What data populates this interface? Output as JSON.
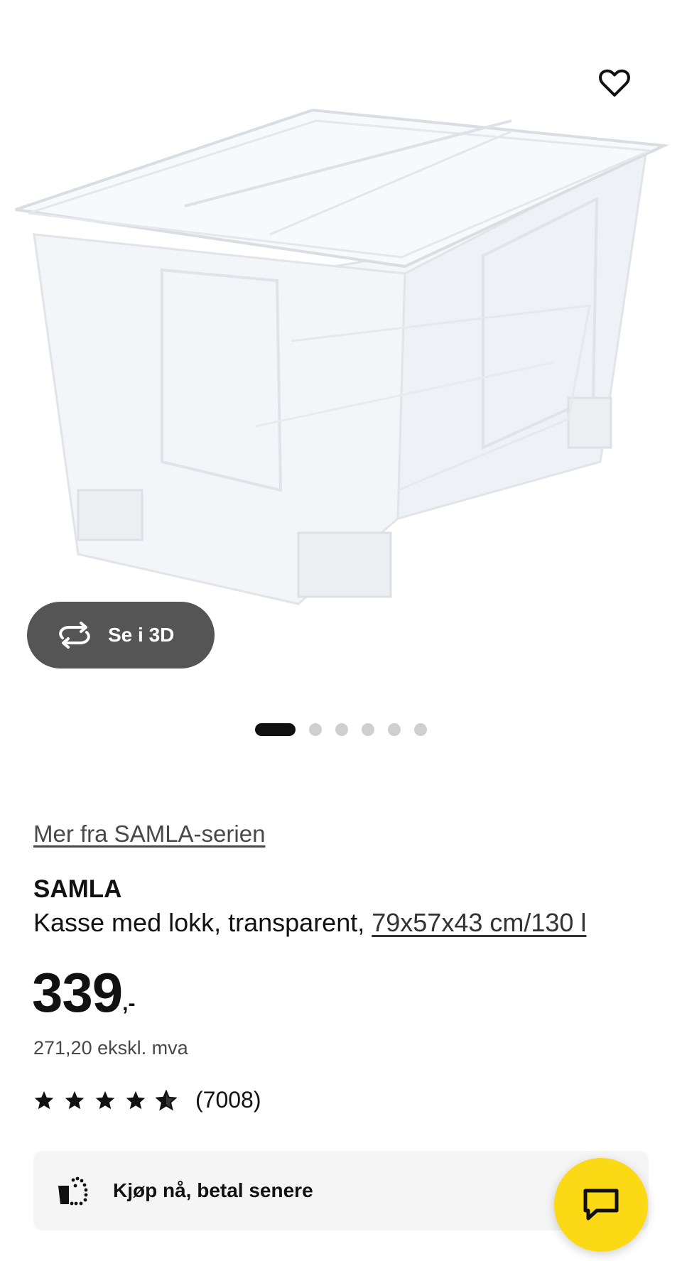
{
  "product": {
    "series_link": "Mer fra SAMLA-serien",
    "name": "SAMLA",
    "description": "Kasse med lokk, transparent, ",
    "measure": "79x57x43 cm/130 l",
    "price_main": "339",
    "price_suffix": ",-",
    "ex_vat": "271,20 ekskl. mva",
    "rating_stars": 4.5,
    "rating_count": "(7008)"
  },
  "gallery": {
    "view3d_label": "Se i 3D",
    "slide_count": 6,
    "active_slide": 1
  },
  "bnpl": {
    "label": "Kjøp nå, betal senere"
  },
  "icons": {
    "wishlist": "heart-icon",
    "view3d": "rotate-3d-icon",
    "bnpl": "bag-dots-icon",
    "chat": "chat-icon",
    "star": "star-icon"
  },
  "colors": {
    "chat_fab": "#fbd914",
    "view3d_bg": "#555555",
    "dot_active": "#111111",
    "dot_inactive": "#cfcfcf"
  }
}
